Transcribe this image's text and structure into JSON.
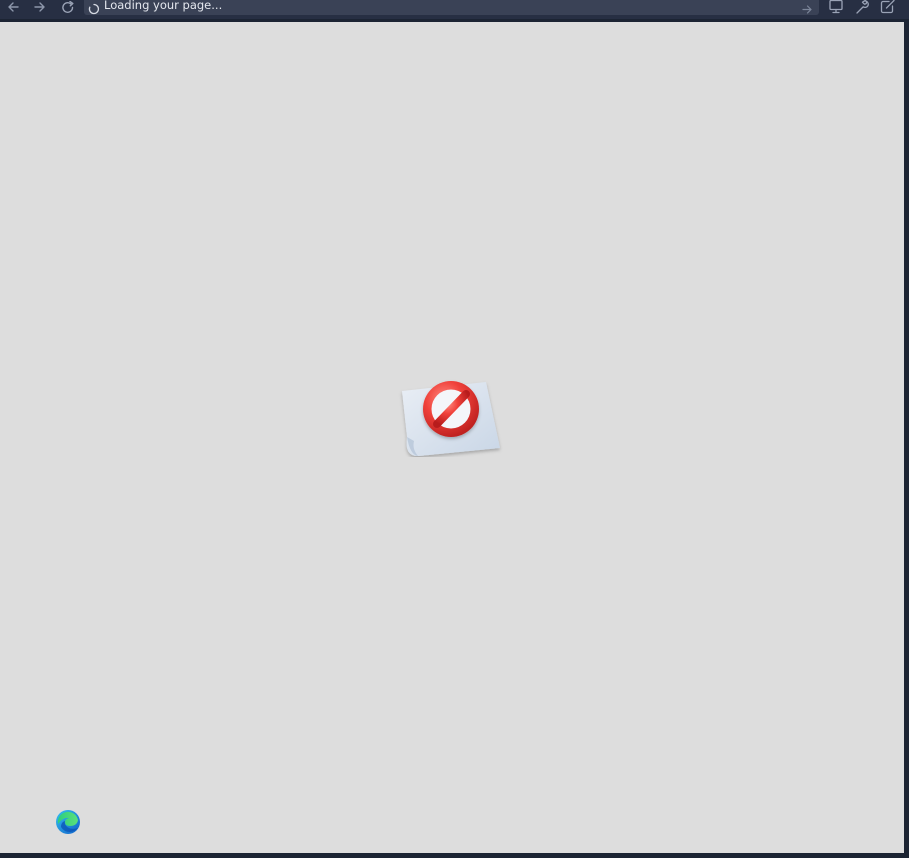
{
  "toolbar": {
    "back_icon": "arrow-left-icon",
    "forward_icon": "arrow-right-icon",
    "reload_icon": "reload-icon",
    "address": {
      "status_text": "Loading your page...",
      "spinner_icon": "loading-spinner-icon",
      "go_icon": "arrow-right-icon"
    },
    "right_icons": [
      "monitor-icon",
      "wrench-icon",
      "external-edit-icon"
    ]
  },
  "content": {
    "background_color": "#dddddd",
    "error_graphic": "blocked-page-icon",
    "browser_logo": "edge-logo"
  },
  "colors": {
    "toolbar_bg": "#272f43",
    "address_bg": "#3a4256",
    "frame_bg": "#1c2433",
    "blocked_red": "#e53935"
  }
}
